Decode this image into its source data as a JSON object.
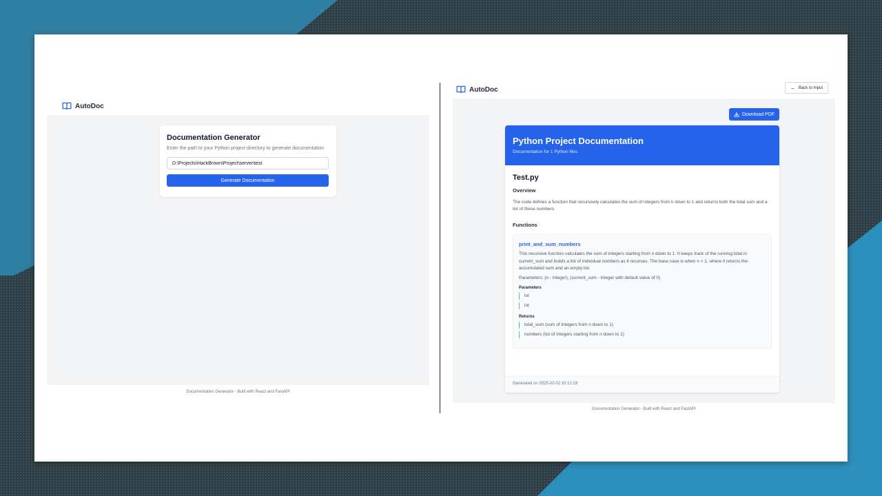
{
  "colors": {
    "accent": "#2563eb",
    "panel_bg": "#f3f4f6",
    "return_bar": "#34d399"
  },
  "left": {
    "brand": "AutoDoc",
    "card": {
      "title": "Documentation Generator",
      "description": "Enter the path to your Python project directory to generate documentation",
      "input_value": "D:\\Projects\\HackBrown\\Project\\server\\test",
      "button_label": "Generate Documentation"
    },
    "footer": "Documentation Generator - Built with React and FastAPI"
  },
  "right": {
    "brand": "AutoDoc",
    "back_label": "Back to Input",
    "download_label": "Download PDF",
    "doc": {
      "title": "Python Project Documentation",
      "subtitle": "Documentation for 1 Python files",
      "file_name": "Test.py",
      "overview_heading": "Overview",
      "overview_text": "The code defines a function that recursively calculates the sum of integers from n down to 1 and returns both the total sum and a list of these numbers.",
      "functions_heading": "Functions",
      "function": {
        "name": "print_and_sum_numbers",
        "description": "This recursive function calculates the sum of integers starting from n down to 1. It keeps track of the running total in current_sum and builds a list of individual numbers as it recurses. The base case is when n < 1, where it returns the accumulated sum and an empty list.",
        "params_line": "Parameters: (n - integer), (current_sum - integer with default value of 0)",
        "parameters_heading": "Parameters",
        "parameters": [
          "int",
          "int"
        ],
        "returns_heading": "Returns",
        "returns": [
          "total_sum (sum of integers from n down to 1)",
          "numbers (list of integers starting from n down to 1)"
        ]
      },
      "generated": "Generated on 2025-02-02 10:12:19"
    },
    "footer": "Documentation Generator - Built with React and FastAPI"
  }
}
